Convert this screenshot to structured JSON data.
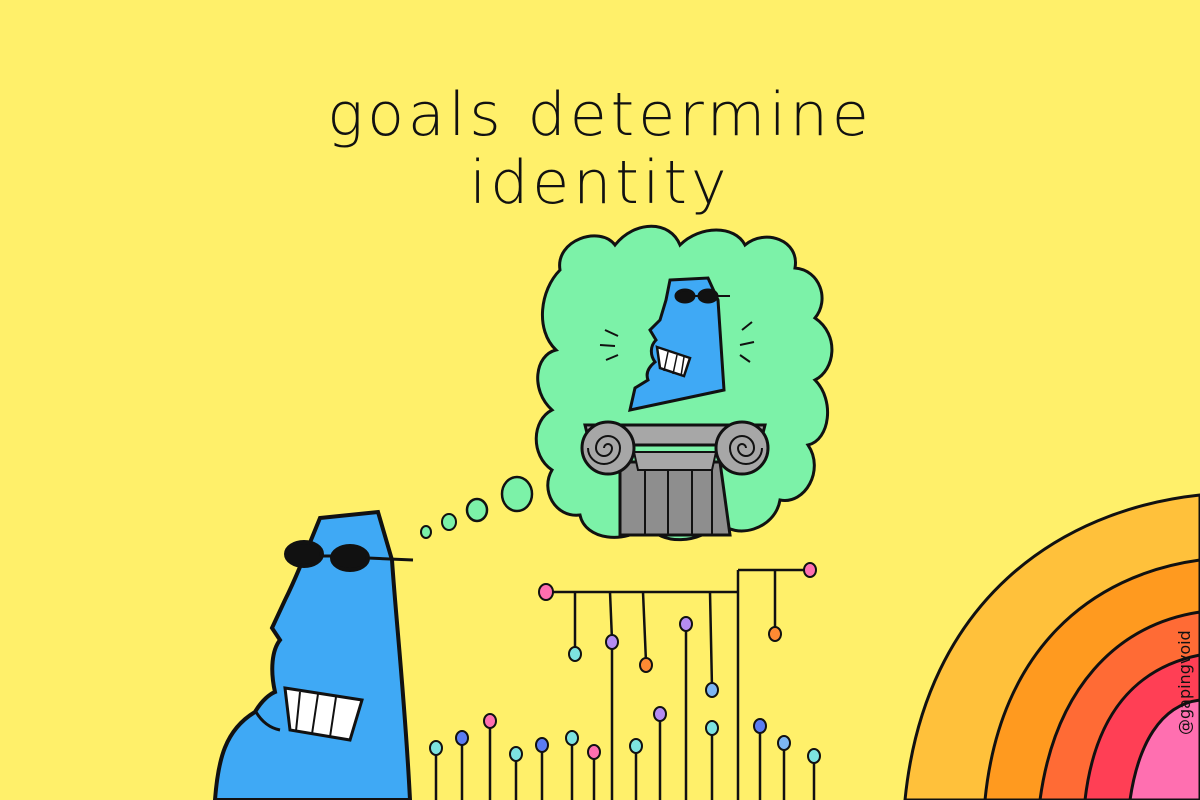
{
  "caption": {
    "line1": "goals determine",
    "line2": "identity"
  },
  "signature": "@gapingvoid",
  "colors": {
    "background": "#FFF06A",
    "figure": "#3FA9F5",
    "thought_cloud": "#7CF2A8",
    "column": "#A7A7A7",
    "rainbow": [
      "#FFC13B",
      "#FF9A1F",
      "#FF6B35",
      "#FF3F55",
      "#FF6FB0"
    ]
  },
  "icons": [
    "sunglasses-icon",
    "ionic-column-icon",
    "rainbow-icon"
  ]
}
